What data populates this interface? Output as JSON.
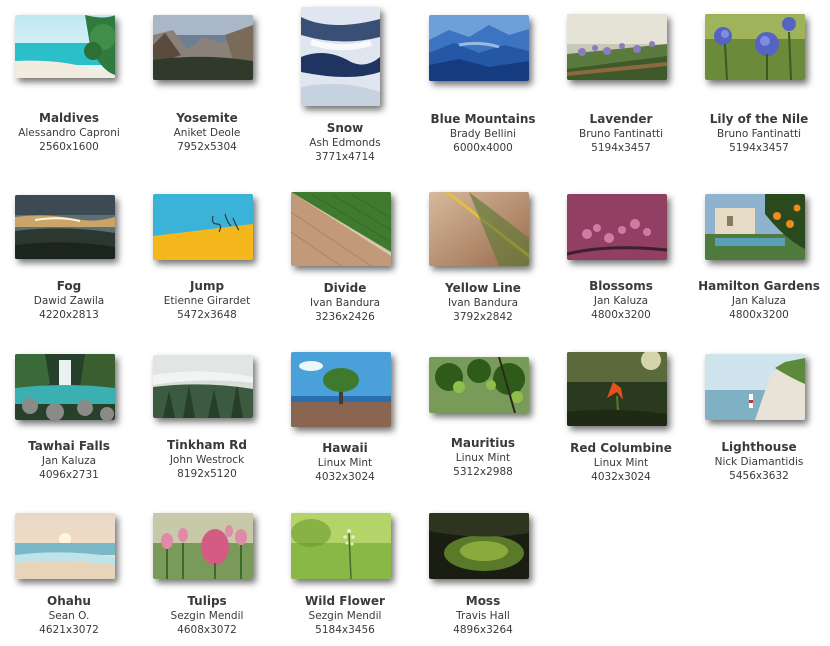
{
  "wallpapers": [
    {
      "title": "Maldives",
      "author": "Alessandro Caproni",
      "resolution": "2560x1600"
    },
    {
      "title": "Yosemite",
      "author": "Aniket Deole",
      "resolution": "7952x5304"
    },
    {
      "title": "Snow",
      "author": "Ash Edmonds",
      "resolution": "3771x4714"
    },
    {
      "title": "Blue Mountains",
      "author": "Brady Bellini",
      "resolution": "6000x4000"
    },
    {
      "title": "Lavender",
      "author": "Bruno Fantinatti",
      "resolution": "5194x3457"
    },
    {
      "title": "Lily of the Nile",
      "author": "Bruno Fantinatti",
      "resolution": "5194x3457"
    },
    {
      "title": "Fog",
      "author": "Dawid Zawila",
      "resolution": "4220x2813"
    },
    {
      "title": "Jump",
      "author": "Etienne Girardet",
      "resolution": "5472x3648"
    },
    {
      "title": "Divide",
      "author": "Ivan Bandura",
      "resolution": "3236x2426"
    },
    {
      "title": "Yellow Line",
      "author": "Ivan Bandura",
      "resolution": "3792x2842"
    },
    {
      "title": "Blossoms",
      "author": "Jan Kaluza",
      "resolution": "4800x3200"
    },
    {
      "title": "Hamilton Gardens",
      "author": "Jan Kaluza",
      "resolution": "4800x3200"
    },
    {
      "title": "Tawhai Falls",
      "author": "Jan Kaluza",
      "resolution": "4096x2731"
    },
    {
      "title": "Tinkham Rd",
      "author": "John Westrock",
      "resolution": "8192x5120"
    },
    {
      "title": "Hawaii",
      "author": "Linux Mint",
      "resolution": "4032x3024"
    },
    {
      "title": "Mauritius",
      "author": "Linux Mint",
      "resolution": "5312x2988"
    },
    {
      "title": "Red Columbine",
      "author": "Linux Mint",
      "resolution": "4032x3024"
    },
    {
      "title": "Lighthouse",
      "author": "Nick Diamantidis",
      "resolution": "5456x3632"
    },
    {
      "title": "Ohahu",
      "author": "Sean O.",
      "resolution": "4621x3072"
    },
    {
      "title": "Tulips",
      "author": "Sezgin Mendil",
      "resolution": "4608x3072"
    },
    {
      "title": "Wild Flower",
      "author": "Sezgin Mendil",
      "resolution": "5184x3456"
    },
    {
      "title": "Moss",
      "author": "Travis Hall",
      "resolution": "4896x3264"
    }
  ]
}
